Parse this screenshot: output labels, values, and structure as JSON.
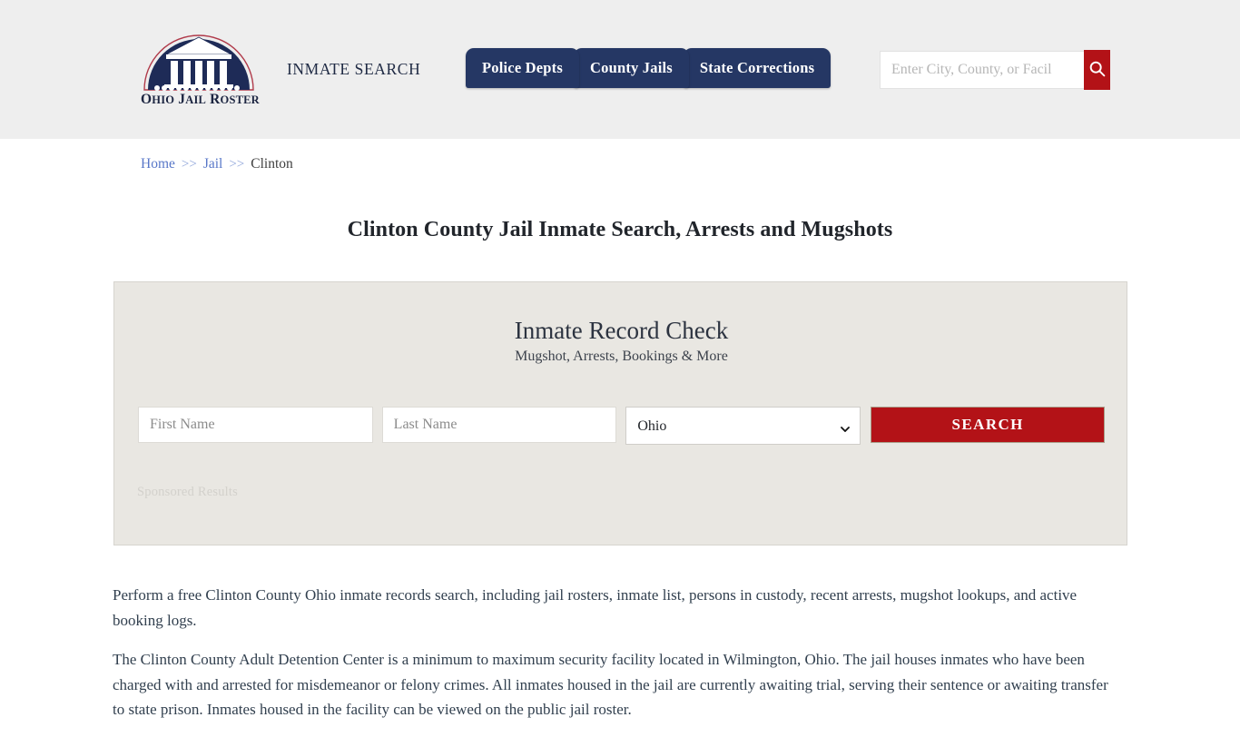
{
  "header": {
    "brand_name": "OHIO JAIL ROSTER",
    "brand_logo_icon": "courthouse-building-icon",
    "tagline": "INMATE SEARCH",
    "nav": [
      {
        "label": "Police Depts"
      },
      {
        "label": "County Jails"
      },
      {
        "label": "State Corrections"
      }
    ],
    "search": {
      "placeholder": "Enter City, County, or Facil",
      "value": "",
      "button_icon": "search-icon"
    },
    "colors": {
      "band": "#eeeeee",
      "navy": "#253764",
      "red": "#b31217"
    }
  },
  "breadcrumb": {
    "items": [
      {
        "label": "Home",
        "link": true
      },
      {
        "label": "Jail",
        "link": true
      },
      {
        "label": "Clinton",
        "link": false
      }
    ],
    "separator": ">>"
  },
  "page_title": "Clinton County Jail Inmate Search, Arrests and Mugshots",
  "search_card": {
    "title": "Inmate Record Check",
    "subtitle": "Mugshot, Arrests, Bookings & More",
    "first_name": {
      "placeholder": "First Name",
      "value": ""
    },
    "last_name": {
      "placeholder": "Last Name",
      "value": ""
    },
    "state": {
      "selected": "Ohio",
      "options": [
        "Ohio"
      ],
      "chevron_icon": "chevron-down-icon"
    },
    "search_button": "SEARCH",
    "sponsored_label": "Sponsored Results"
  },
  "content": {
    "paragraph_1": "Perform a free Clinton County Ohio inmate records search, including jail rosters, inmate list, persons in custody, recent arrests, mugshot lookups, and active booking logs.",
    "paragraph_2": "The Clinton County Adult Detention Center is a minimum to maximum security facility located in Wilmington, Ohio. The jail houses inmates who have been charged with and arrested for misdemeanor or felony crimes. All inmates housed in the jail are currently awaiting trial, serving their sentence or awaiting transfer to state prison. Inmates housed in the facility can be viewed on the public jail roster."
  }
}
